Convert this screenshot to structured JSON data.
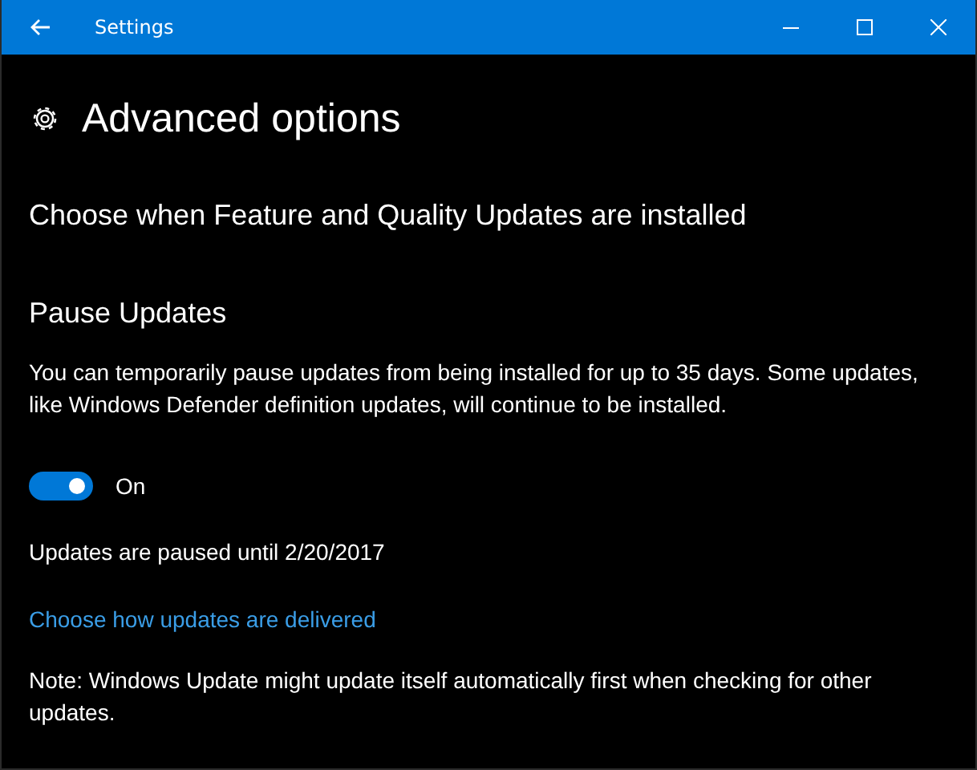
{
  "window": {
    "title": "Settings"
  },
  "page": {
    "title": "Advanced options"
  },
  "section_heading": "Choose when Feature and Quality Updates are installed",
  "pause": {
    "heading": "Pause Updates",
    "description": "You can temporarily pause updates from being installed for up to 35 days. Some updates, like Windows Defender definition updates, will continue to be installed.",
    "toggle": {
      "on": true,
      "label": "On"
    },
    "status": "Updates are paused until 2/20/2017"
  },
  "link": "Choose how updates are delivered",
  "note": "Note: Windows Update might update itself automatically first when checking for other updates."
}
